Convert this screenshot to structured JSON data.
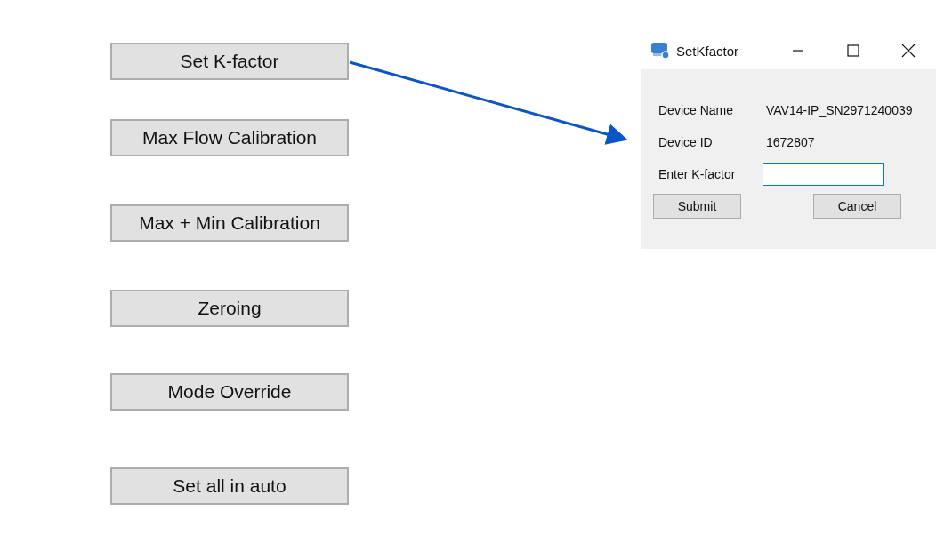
{
  "buttons": [
    {
      "label": "Set K-factor"
    },
    {
      "label": "Max Flow Calibration"
    },
    {
      "label": "Max + Min Calibration"
    },
    {
      "label": "Zeroing"
    },
    {
      "label": "Mode Override"
    },
    {
      "label": "Set all in auto"
    }
  ],
  "dialog": {
    "title": "SetKfactor",
    "fields": [
      {
        "label": "Device Name",
        "value": "VAV14-IP_SN2971240039",
        "kind": "text"
      },
      {
        "label": "Device ID",
        "value": "1672807",
        "kind": "text"
      },
      {
        "label": "Enter K-factor",
        "kind": "input"
      }
    ],
    "buttons": [
      "Submit",
      "Cancel"
    ]
  }
}
